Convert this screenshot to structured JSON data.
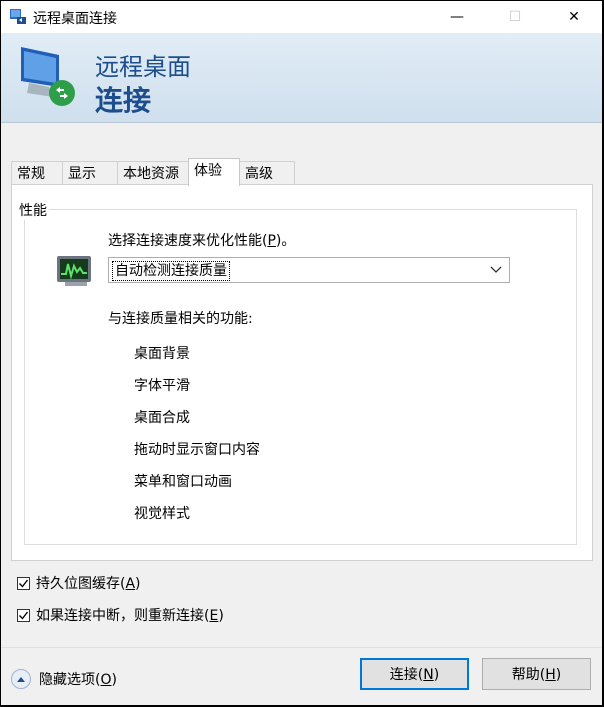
{
  "window": {
    "title": "远程桌面连接",
    "controls": {
      "minimize": "—",
      "maximize": "☐",
      "close": "✕"
    }
  },
  "banner": {
    "line1": "远程桌面",
    "line2": "连接"
  },
  "tabs": [
    {
      "label": "常规"
    },
    {
      "label": "显示"
    },
    {
      "label": "本地资源"
    },
    {
      "label": "体验",
      "active": true
    },
    {
      "label": "高级"
    }
  ],
  "performance": {
    "group_title": "性能",
    "speed_label_pre": "选择连接速度来优化性能(",
    "speed_label_key": "P",
    "speed_label_post": ")。",
    "selected_option": "自动检测连接质量",
    "features_label": "与连接质量相关的功能:",
    "features": [
      "桌面背景",
      "字体平滑",
      "桌面合成",
      "拖动时显示窗口内容",
      "菜单和窗口动画",
      "视觉样式"
    ]
  },
  "options": {
    "persistent_cache": {
      "label_pre": "持久位图缓存(",
      "key": "A",
      "label_post": ")",
      "checked": true
    },
    "reconnect": {
      "label_pre": "如果连接中断，则重新连接(",
      "key": "E",
      "label_post": ")",
      "checked": true
    }
  },
  "footer": {
    "hide_options": {
      "pre": "隐藏选项(",
      "key": "O",
      "post": ")"
    },
    "connect": {
      "pre": "连接(",
      "key": "N",
      "post": ")"
    },
    "help": {
      "pre": "帮助(",
      "key": "H",
      "post": ")"
    }
  },
  "colors": {
    "accent": "#0078d7",
    "banner_text": "#1d4d8c"
  }
}
